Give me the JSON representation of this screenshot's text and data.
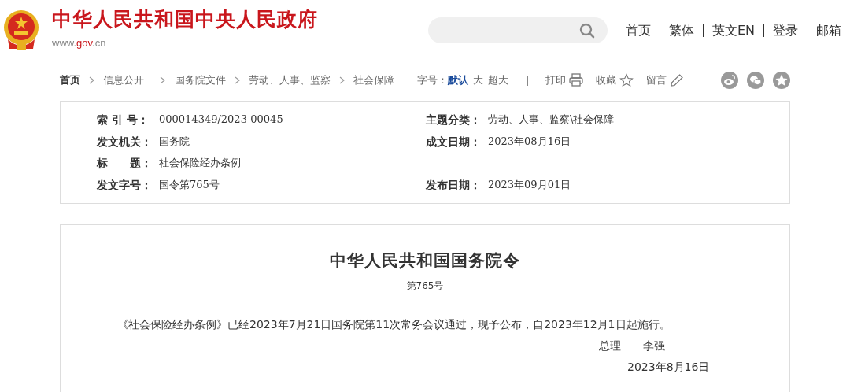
{
  "header": {
    "site_title": "中华人民共和国中央人民政府",
    "site_url": [
      {
        "text": "www.",
        "kind": "plain"
      },
      {
        "text": "gov",
        "kind": "accent"
      },
      {
        "text": ".cn",
        "kind": "plain"
      }
    ],
    "nav": [
      "首页",
      "繁体",
      "英文EN",
      "登录",
      "邮箱"
    ]
  },
  "breadcrumb": [
    "首页",
    "信息公开",
    "国务院文件",
    "劳动、人事、监察",
    "社会保障"
  ],
  "toolbar": {
    "font_size_label": "字号：",
    "font_sizes": [
      {
        "label": "默认",
        "selected": true
      },
      {
        "label": "大",
        "selected": false
      },
      {
        "label": "超大",
        "selected": false
      }
    ],
    "actions": [
      {
        "label": "打印",
        "kind": "print"
      },
      {
        "label": "收藏",
        "kind": "favorite"
      },
      {
        "label": "留言",
        "kind": "comment"
      }
    ],
    "share": [
      {
        "kind": "swirl"
      },
      {
        "kind": "chat"
      },
      {
        "kind": "star"
      }
    ]
  },
  "meta": [
    {
      "left": {
        "label": "索 引 号：",
        "value": "000014349/2023-00045"
      },
      "right": {
        "label": "主题分类：",
        "value": "劳动、人事、监察\\社会保障"
      }
    },
    {
      "left": {
        "label": "发文机关：",
        "value": "国务院"
      },
      "right": {
        "label": "成文日期：",
        "value": "2023年08月16日"
      }
    },
    {
      "left": {
        "label": "标　　题：",
        "value": "社会保险经办条例"
      }
    },
    {
      "left": {
        "label": "发文字号：",
        "value": "国令第765号"
      },
      "right": {
        "label": "发布日期：",
        "value": "2023年09月01日"
      }
    }
  ],
  "document": {
    "title": "中华人民共和国国务院令",
    "number": "第765号",
    "body": "《社会保险经办条例》已经2023年7月21日国务院第11次常务会议通过，现予公布，自2023年12月1日起施行。",
    "signer_title": "总理",
    "signer_name": "李强",
    "date": "2023年8月16日"
  }
}
